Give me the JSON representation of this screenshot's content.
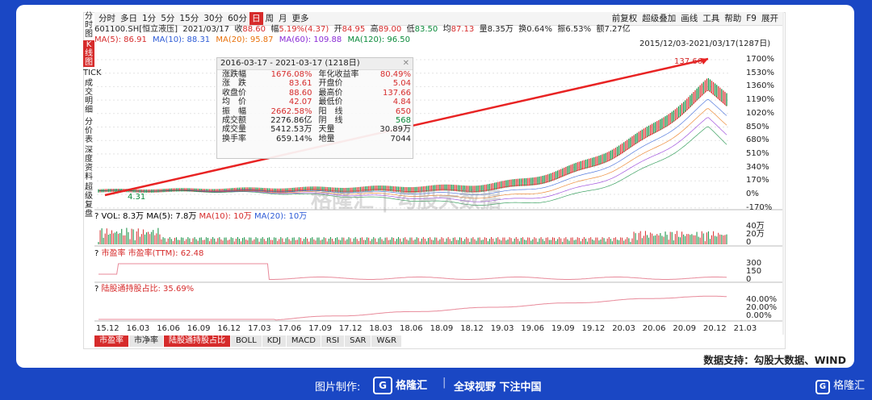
{
  "sidebar": {
    "items": [
      {
        "label": "分时图",
        "active": false
      },
      {
        "label": "K线图",
        "active": true
      },
      {
        "label": "TICK",
        "active": false
      },
      {
        "label": "成交明细",
        "active": false
      },
      {
        "label": "分价表",
        "active": false
      },
      {
        "label": "深度资料",
        "active": false
      },
      {
        "label": "超级复盘",
        "active": false
      }
    ]
  },
  "toolbar": {
    "periods": [
      "分时",
      "多日",
      "1分",
      "5分",
      "15分",
      "30分",
      "60分",
      "日",
      "周",
      "月",
      "更多"
    ],
    "active_period": "日",
    "right": [
      "前复权",
      "超级叠加",
      "画线",
      "工具",
      "帮助",
      "F9",
      "展开"
    ]
  },
  "quote": {
    "code": "601100.SH[恒立液压]",
    "date": "2021/03/17",
    "close_label": "收",
    "close": "88.60",
    "amp_label": "幅",
    "change": "5.19%(4.37)",
    "open_label": "开",
    "open": "84.95",
    "high_label": "高",
    "high": "89.00",
    "low_label": "低",
    "low": "83.50",
    "avg_label": "均",
    "avg": "87.13",
    "vol_label": "量",
    "volume": "8.35万",
    "turn_label": "换",
    "turnover": "0.64%",
    "swing_label": "振",
    "swing": "6.53%",
    "amount_label": "额",
    "amount": "7.27亿"
  },
  "ma": {
    "ma5": "MA(5): 86.91",
    "ma10": "MA(10): 88.31",
    "ma20": "MA(20): 95.87",
    "ma60": "MA(60): 109.88",
    "ma120": "MA(120): 96.50"
  },
  "range": "2015/12/03-2021/03/17(1287日)",
  "popup": {
    "start": "2016-03-17",
    "end": "2021-03-17",
    "days": "(1218日)",
    "rows": [
      [
        "涨跌幅",
        "1676.08%",
        "年化收益率",
        "80.49%"
      ],
      [
        "涨　跌",
        "83.61",
        "开盘价",
        "5.04"
      ],
      [
        "收盘价",
        "88.60",
        "最高价",
        "137.66"
      ],
      [
        "均　价",
        "42.07",
        "最低价",
        "4.84"
      ],
      [
        "振　幅",
        "2662.58%",
        "阳　线",
        "650"
      ],
      [
        "成交额",
        "2276.86亿",
        "阴　线",
        "568"
      ],
      [
        "成交量",
        "5412.53万",
        "天量",
        "30.89万"
      ],
      [
        "换手率",
        "659.14%",
        "地量",
        "7044"
      ]
    ]
  },
  "annotations": {
    "high": "137.66",
    "low": "4.31"
  },
  "price_axis": [
    "1700%",
    "1530%",
    "1360%",
    "1190%",
    "1020%",
    "850%",
    "680%",
    "510%",
    "340%",
    "170%",
    "0%",
    "-170%"
  ],
  "volume": {
    "label_vol": "VOL: 8.3万",
    "label_ma5": "MA(5): 7.8万",
    "label_ma10": "MA(10): 10万",
    "label_ma20": "MA(20): 10万",
    "axis": [
      "40万",
      "20万",
      "0"
    ]
  },
  "pe": {
    "label": "市盈率",
    "value": "市盈率(TTM): 62.48",
    "axis": [
      "300",
      "150",
      "0"
    ]
  },
  "hk": {
    "label": "陆股通持股占比: 35.69%",
    "axis": [
      "40.00%",
      "20.00%",
      "0.00%"
    ]
  },
  "xaxis": [
    "15.12",
    "16.03",
    "16.06",
    "16.09",
    "16.12",
    "17.03",
    "17.06",
    "17.09",
    "17.12",
    "18.03",
    "18.06",
    "18.09",
    "18.12",
    "19.03",
    "19.06",
    "19.09",
    "19.12",
    "20.03",
    "20.06",
    "20.09",
    "20.12",
    "21.03"
  ],
  "bottom_tabs": [
    {
      "label": "市盈率",
      "active": true
    },
    {
      "label": "市净率",
      "active": false
    },
    {
      "label": "陆股通持股占比",
      "active": true
    },
    {
      "label": "BOLL",
      "active": false
    },
    {
      "label": "KDJ",
      "active": false
    },
    {
      "label": "MACD",
      "active": false
    },
    {
      "label": "RSI",
      "active": false
    },
    {
      "label": "SAR",
      "active": false
    },
    {
      "label": "W&R",
      "active": false
    }
  ],
  "watermark": "格隆汇 | 勾股大数据",
  "source": "数据支持：勾股大数据、WIND",
  "footer": {
    "made_by": "图片制作:",
    "brand": "格隆汇",
    "slogan": "全球视野 下注中国"
  },
  "colors": {
    "accent": "#d62b2b",
    "bg": "#1a47c4",
    "up": "#d62b2b",
    "down": "#0a8a3a"
  }
}
